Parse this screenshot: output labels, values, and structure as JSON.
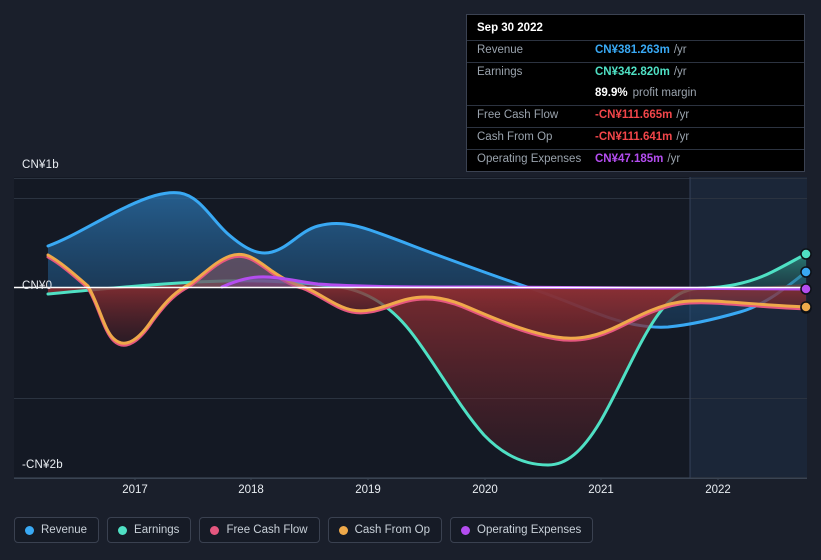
{
  "colors": {
    "revenue": "#39a9f4",
    "earnings": "#4fe0c4",
    "free_cash_flow": "#e5577f",
    "cash_from_op": "#efa94a",
    "operating_expenses": "#b44df0",
    "negative_text": "#f2464a",
    "background": "#1a1f2b",
    "plot_background": "#141924",
    "forecast_background": "#182133",
    "gridline": "#2b3340",
    "zero_line": "#ffffff"
  },
  "tooltip": {
    "date": "Sep 30 2022",
    "rows": [
      {
        "label": "Revenue",
        "value": "CN¥381.263m",
        "suffix": "/yr",
        "color": "#39a9f4"
      },
      {
        "label": "Earnings",
        "value": "CN¥342.820m",
        "suffix": "/yr",
        "color": "#4fe0c4"
      },
      {
        "label": "",
        "value": "89.9%",
        "suffix": "profit margin",
        "color": "#ffffff",
        "margin_row": true
      },
      {
        "label": "Free Cash Flow",
        "value": "-CN¥111.665m",
        "suffix": "/yr",
        "color": "#f2464a"
      },
      {
        "label": "Cash From Op",
        "value": "-CN¥111.641m",
        "suffix": "/yr",
        "color": "#f2464a"
      },
      {
        "label": "Operating Expenses",
        "value": "CN¥47.185m",
        "suffix": "/yr",
        "color": "#b44df0"
      }
    ]
  },
  "legend": {
    "items": [
      {
        "label": "Revenue",
        "color": "#39a9f4"
      },
      {
        "label": "Earnings",
        "color": "#4fe0c4"
      },
      {
        "label": "Free Cash Flow",
        "color": "#e5577f"
      },
      {
        "label": "Cash From Op",
        "color": "#efa94a"
      },
      {
        "label": "Operating Expenses",
        "color": "#b44df0"
      }
    ]
  },
  "axis": {
    "y_top_label": "CN¥1b",
    "y_zero_label": "CN¥0",
    "y_bottom_label": "-CN¥2b",
    "x_ticks": [
      "2017",
      "2018",
      "2019",
      "2020",
      "2021",
      "2022"
    ]
  },
  "chart_data": {
    "type": "area",
    "title": "",
    "xlabel": "",
    "ylabel": "CN¥",
    "ylim": [
      -2000,
      1000
    ],
    "y_tick_values": [
      1000,
      0,
      -2000
    ],
    "y_tick_labels": [
      "CN¥1b",
      "CN¥0",
      "-CN¥2b"
    ],
    "x": [
      "2016.4",
      "2016.7",
      "2017.0",
      "2017.25",
      "2017.5",
      "2017.75",
      "2018.0",
      "2018.25",
      "2018.5",
      "2018.75",
      "2019.0",
      "2019.25",
      "2019.5",
      "2019.75",
      "2020.0",
      "2020.25",
      "2020.5",
      "2020.75",
      "2021.0",
      "2021.25",
      "2021.5",
      "2021.75",
      "2022.0",
      "2022.25",
      "2022.5",
      "2022.75"
    ],
    "x_tick_labels": [
      "2017",
      "2018",
      "2019",
      "2020",
      "2021",
      "2022"
    ],
    "grid": true,
    "legend_position": "bottom",
    "forecast_start": "2021.75",
    "units": "CN¥ millions per year",
    "series": [
      {
        "name": "Revenue",
        "color": "#39a9f4",
        "values": [
          790,
          840,
          900,
          960,
          1000,
          985,
          930,
          880,
          900,
          935,
          925,
          900,
          870,
          840,
          800,
          770,
          700,
          640,
          600,
          560,
          545,
          540,
          540,
          560,
          640,
          381
        ]
      },
      {
        "name": "Earnings",
        "color": "#4fe0c4",
        "values": [
          -60,
          -45,
          -20,
          0,
          15,
          25,
          30,
          40,
          35,
          30,
          25,
          20,
          15,
          -10,
          -120,
          -450,
          -1100,
          -1700,
          -1960,
          -1500,
          -700,
          -150,
          40,
          60,
          200,
          343
        ]
      },
      {
        "name": "Free Cash Flow",
        "color": "#e5577f",
        "values": [
          300,
          0,
          -430,
          -550,
          -380,
          -120,
          140,
          330,
          390,
          330,
          210,
          90,
          -30,
          -110,
          -90,
          -120,
          -200,
          -290,
          -330,
          -300,
          -230,
          -160,
          -140,
          -140,
          -130,
          -112
        ]
      },
      {
        "name": "Cash From Op",
        "color": "#efa94a",
        "values": [
          300,
          0,
          -430,
          -550,
          -380,
          -120,
          140,
          330,
          390,
          330,
          210,
          90,
          -30,
          -110,
          -90,
          -120,
          -200,
          -290,
          -330,
          -300,
          -230,
          -160,
          -140,
          -140,
          -130,
          -112
        ]
      },
      {
        "name": "Operating Expenses",
        "color": "#b44df0",
        "values": [
          null,
          null,
          null,
          null,
          null,
          0,
          55,
          75,
          60,
          50,
          48,
          46,
          45,
          44,
          44,
          44,
          44,
          44,
          45,
          45,
          46,
          46,
          46,
          47,
          47,
          47
        ]
      }
    ]
  }
}
